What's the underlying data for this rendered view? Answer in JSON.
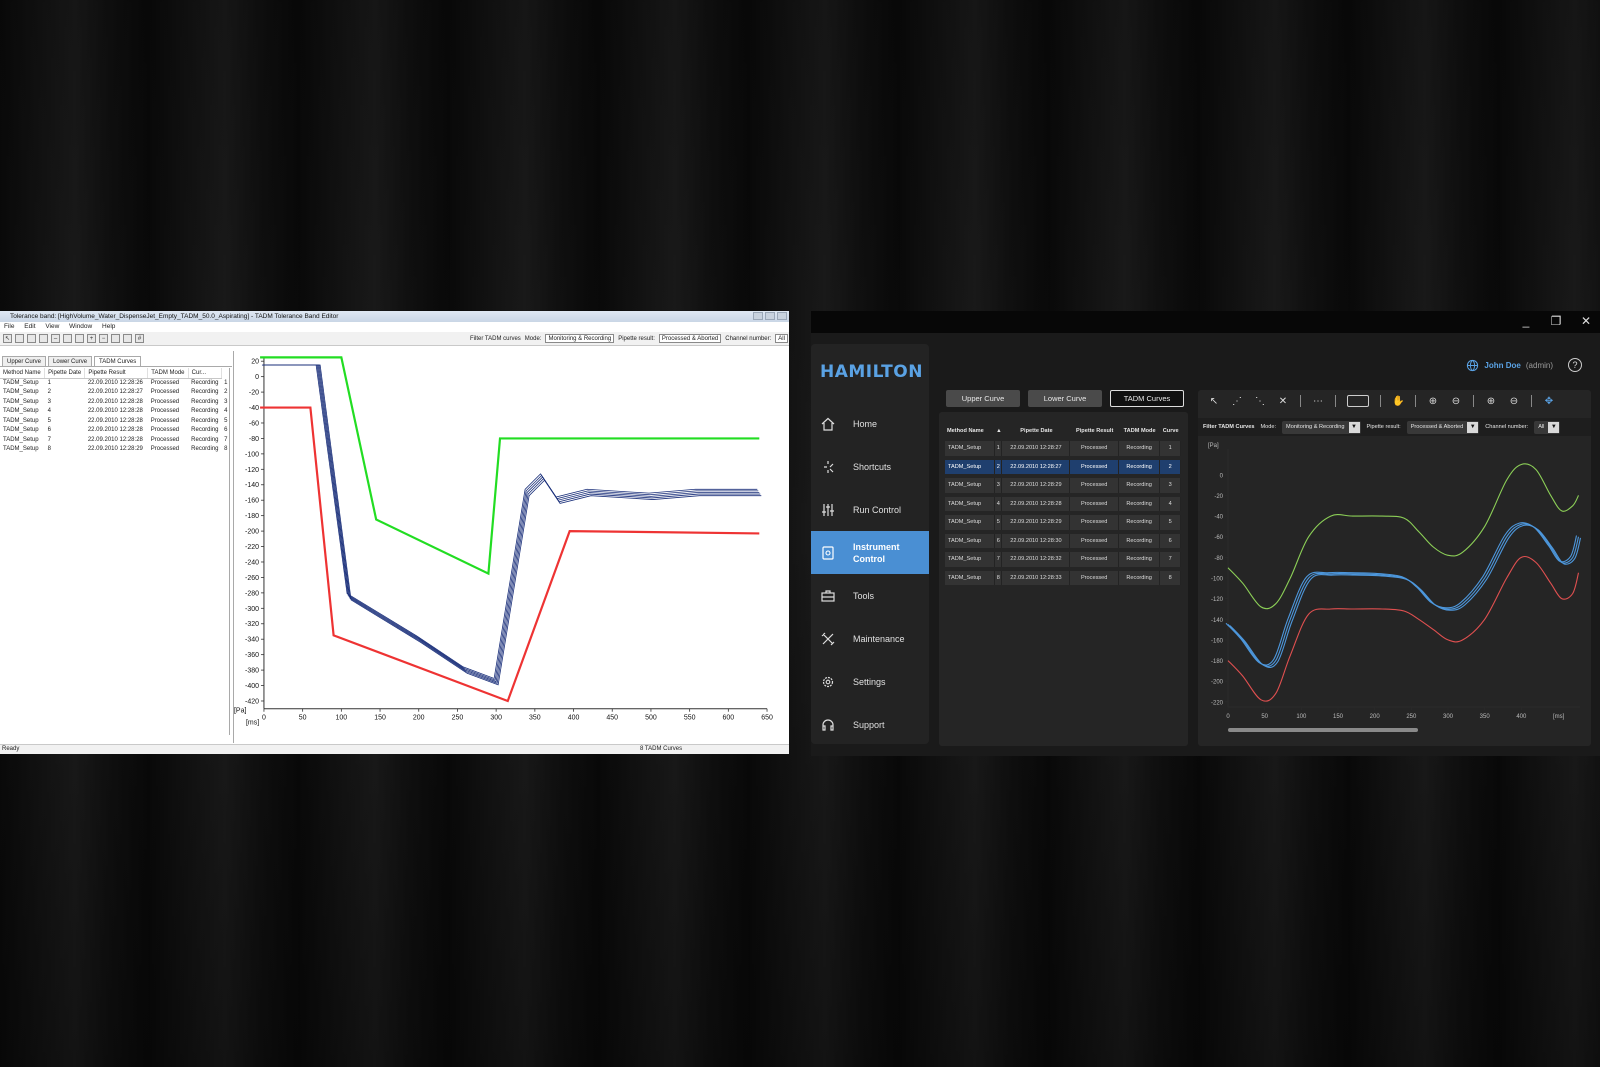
{
  "old_app": {
    "title": "Tolerance band: [HighVolume_Water_DispenseJet_Empty_TADM_50.0_Aspirating] - TADM Tolerance Band Editor",
    "menu": [
      "File",
      "Edit",
      "View",
      "Window",
      "Help"
    ],
    "filter": {
      "label": "Filter TADM curves",
      "mode_label": "Mode:",
      "mode_value": "Monitoring & Recording",
      "pipette_label": "Pipette result:",
      "pipette_value": "Processed & Aborted",
      "channel_label": "Channel number:",
      "channel_value": "All"
    },
    "tabs": [
      "Upper Curve",
      "Lower Curve",
      "TADM Curves"
    ],
    "columns": [
      "Method Name",
      "Pipette Date",
      "Pipette Result",
      "TADM Mode",
      "Cur..."
    ],
    "rows": [
      [
        "TADM_Setup",
        "1",
        "22.09.2010 12:28:26",
        "Processed",
        "Recording",
        "1"
      ],
      [
        "TADM_Setup",
        "2",
        "22.09.2010 12:28:27",
        "Processed",
        "Recording",
        "2"
      ],
      [
        "TADM_Setup",
        "3",
        "22.09.2010 12:28:28",
        "Processed",
        "Recording",
        "3"
      ],
      [
        "TADM_Setup",
        "4",
        "22.09.2010 12:28:28",
        "Processed",
        "Recording",
        "4"
      ],
      [
        "TADM_Setup",
        "5",
        "22.09.2010 12:28:28",
        "Processed",
        "Recording",
        "5"
      ],
      [
        "TADM_Setup",
        "6",
        "22.09.2010 12:28:28",
        "Processed",
        "Recording",
        "6"
      ],
      [
        "TADM_Setup",
        "7",
        "22.09.2010 12:28:28",
        "Processed",
        "Recording",
        "7"
      ],
      [
        "TADM_Setup",
        "8",
        "22.09.2010 12:28:29",
        "Processed",
        "Recording",
        "8"
      ]
    ],
    "status_left": "Ready",
    "status_right": "8 TADM Curves"
  },
  "new_app": {
    "brand": "HAMILTON",
    "user_name": "John Doe",
    "user_role": "(admin)",
    "help": "?",
    "nav": [
      {
        "label": "Home",
        "icon": "home-icon"
      },
      {
        "label": "Shortcuts",
        "icon": "shortcuts-icon"
      },
      {
        "label": "Run Control",
        "icon": "sliders-icon"
      },
      {
        "label": "Instrument Control",
        "icon": "instrument-icon",
        "active": true
      },
      {
        "label": "Tools",
        "icon": "toolbox-icon"
      },
      {
        "label": "Maintenance",
        "icon": "wrench-icon"
      },
      {
        "label": "Settings",
        "icon": "gear-icon"
      },
      {
        "label": "Support",
        "icon": "headset-icon"
      }
    ],
    "tabs": [
      "Upper Curve",
      "Lower Curve",
      "TADM Curves"
    ],
    "columns": [
      "Method Name",
      "▲",
      "Pipette Date",
      "Pipette Result",
      "TADM Mode",
      "Curve"
    ],
    "rows": [
      [
        "TADM_Setup",
        "1",
        "22.09.2010 12:28:27",
        "Processed",
        "Recording",
        "1"
      ],
      [
        "TADM_Setup",
        "2",
        "22.09.2010 12:28:27",
        "Processed",
        "Recording",
        "2"
      ],
      [
        "TADM_Setup",
        "3",
        "22.09.2010 12:28:29",
        "Processed",
        "Recording",
        "3"
      ],
      [
        "TADM_Setup",
        "4",
        "22.09.2010 12:28:28",
        "Processed",
        "Recording",
        "4"
      ],
      [
        "TADM_Setup",
        "5",
        "22.09.2010 12:28:29",
        "Processed",
        "Recording",
        "5"
      ],
      [
        "TADM_Setup",
        "6",
        "22.09.2010 12:28:30",
        "Processed",
        "Recording",
        "6"
      ],
      [
        "TADM_Setup",
        "7",
        "22.09.2010 12:28:32",
        "Processed",
        "Recording",
        "7"
      ],
      [
        "TADM_Setup",
        "8",
        "22.09.2010 12:28:33",
        "Processed",
        "Recording",
        "8"
      ]
    ],
    "selected_row": 1,
    "filter": {
      "label": "Filter TADM Curves",
      "mode_label": "Mode:",
      "mode_value": "Monitoring & Recording",
      "pipette_label": "Pipette result:",
      "pipette_value": "Processed & Aborted",
      "channel_label": "Channel number:",
      "channel_value": "All"
    }
  },
  "chart_data": [
    {
      "type": "line",
      "title": "",
      "xlabel": "[ms]",
      "ylabel": "[Pa]",
      "xlim": [
        0,
        650
      ],
      "ylim": [
        -430,
        25
      ],
      "xticks": [
        0,
        50,
        100,
        150,
        200,
        250,
        300,
        350,
        400,
        450,
        500,
        550,
        600,
        650
      ],
      "yticks": [
        20,
        0,
        -20,
        -40,
        -60,
        -80,
        -100,
        -120,
        -140,
        -160,
        -180,
        -200,
        -220,
        -240,
        -260,
        -280,
        -300,
        -320,
        -340,
        -360,
        -380,
        -400,
        -420
      ],
      "series": [
        {
          "color": "#22dd22",
          "x": [
            -5,
            100,
            145,
            290,
            305,
            640
          ],
          "y": [
            25,
            25,
            -185,
            -255,
            -80,
            -80
          ]
        },
        {
          "color": "#ee3333",
          "x": [
            -5,
            60,
            90,
            315,
            395,
            640
          ],
          "y": [
            -40,
            -40,
            -335,
            -420,
            -200,
            -203
          ]
        },
        {
          "color": "#1a2f7a",
          "x": [
            0,
            70,
            110,
            200,
            260,
            300,
            340,
            360,
            380,
            420,
            500,
            560,
            640
          ],
          "y": [
            15,
            15,
            -285,
            -340,
            -380,
            -395,
            -150,
            -130,
            -160,
            -150,
            -155,
            -150,
            -150
          ]
        }
      ]
    },
    {
      "type": "line",
      "title": "",
      "xlabel": "[ms]",
      "ylabel": "[Pa]",
      "xlim": [
        0,
        480
      ],
      "ylim": [
        -225,
        25
      ],
      "xticks": [
        0,
        50,
        100,
        150,
        200,
        250,
        300,
        350,
        400
      ],
      "yticks": [
        0,
        -20,
        -40,
        -60,
        -80,
        -100,
        -120,
        -140,
        -160,
        -180,
        -200,
        -220
      ],
      "series": [
        {
          "color": "#8ccf57",
          "x": [
            0,
            20,
            45,
            65,
            85,
            110,
            140,
            170,
            210,
            240,
            260,
            280,
            300,
            320,
            350,
            380,
            400,
            420,
            440,
            455,
            470,
            478
          ],
          "y": [
            -90,
            -105,
            -128,
            -125,
            -100,
            -60,
            -40,
            -40,
            -40,
            -42,
            -55,
            -70,
            -78,
            -75,
            -50,
            -5,
            10,
            5,
            -20,
            -35,
            -30,
            -20
          ]
        },
        {
          "color": "#4d97dc",
          "x": [
            0,
            20,
            45,
            65,
            85,
            110,
            140,
            170,
            210,
            240,
            260,
            280,
            300,
            320,
            350,
            380,
            400,
            420,
            440,
            455,
            470,
            478
          ],
          "y": [
            -145,
            -160,
            -183,
            -180,
            -140,
            -100,
            -96,
            -96,
            -97,
            -100,
            -110,
            -125,
            -130,
            -125,
            -100,
            -60,
            -48,
            -52,
            -70,
            -85,
            -80,
            -60
          ]
        },
        {
          "color": "#e05050",
          "x": [
            0,
            20,
            45,
            65,
            85,
            110,
            140,
            170,
            210,
            240,
            260,
            280,
            300,
            320,
            350,
            380,
            400,
            420,
            440,
            455,
            470,
            478
          ],
          "y": [
            -180,
            -195,
            -218,
            -212,
            -175,
            -135,
            -130,
            -130,
            -130,
            -132,
            -140,
            -150,
            -160,
            -160,
            -140,
            -100,
            -80,
            -85,
            -105,
            -120,
            -115,
            -95
          ]
        }
      ]
    }
  ]
}
